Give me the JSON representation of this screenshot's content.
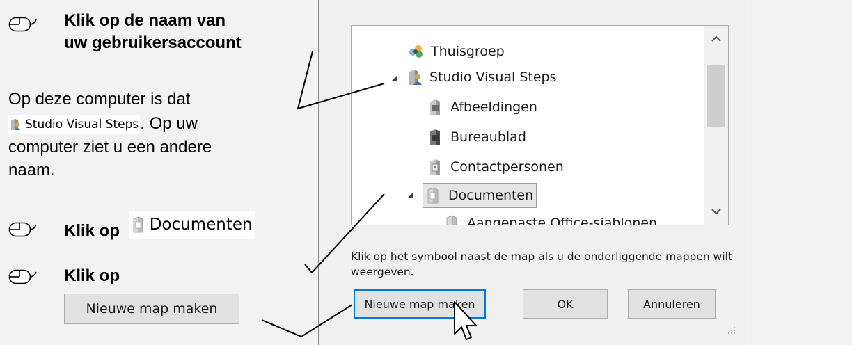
{
  "instructions": {
    "step1_line1": "Klik op de naam van",
    "step1_line2": "uw gebruikersaccount",
    "para_line1": "Op deze computer is dat",
    "para_chip": "Studio Visual Steps",
    "para_after_chip": ". Op uw",
    "para_line3": "computer ziet u een andere",
    "para_line4": "naam.",
    "step2_prefix": "Klik op",
    "step2_chip": "Documenten",
    "step3_prefix": "Klik op",
    "step3_button": "Nieuwe map maken"
  },
  "dialog": {
    "tree_items": [
      {
        "label": "Thuisgroep",
        "icon": "homegroup-icon"
      },
      {
        "label": "Studio Visual Steps",
        "icon": "user-folder-icon"
      },
      {
        "label": "Afbeeldingen",
        "icon": "pictures-folder-icon"
      },
      {
        "label": "Bureaublad",
        "icon": "desktop-folder-icon"
      },
      {
        "label": "Contactpersonen",
        "icon": "contacts-folder-icon"
      },
      {
        "label": "Documenten",
        "icon": "documents-folder-icon"
      },
      {
        "label": "Aangepaste Office-sjablonen",
        "icon": "folder-icon"
      }
    ],
    "hint": "Klik op het symbool naast de map als u de onderliggende mappen wilt weergeven.",
    "new_folder_label": "Nieuwe map maken",
    "ok_label": "OK",
    "cancel_label": "Annuleren"
  }
}
